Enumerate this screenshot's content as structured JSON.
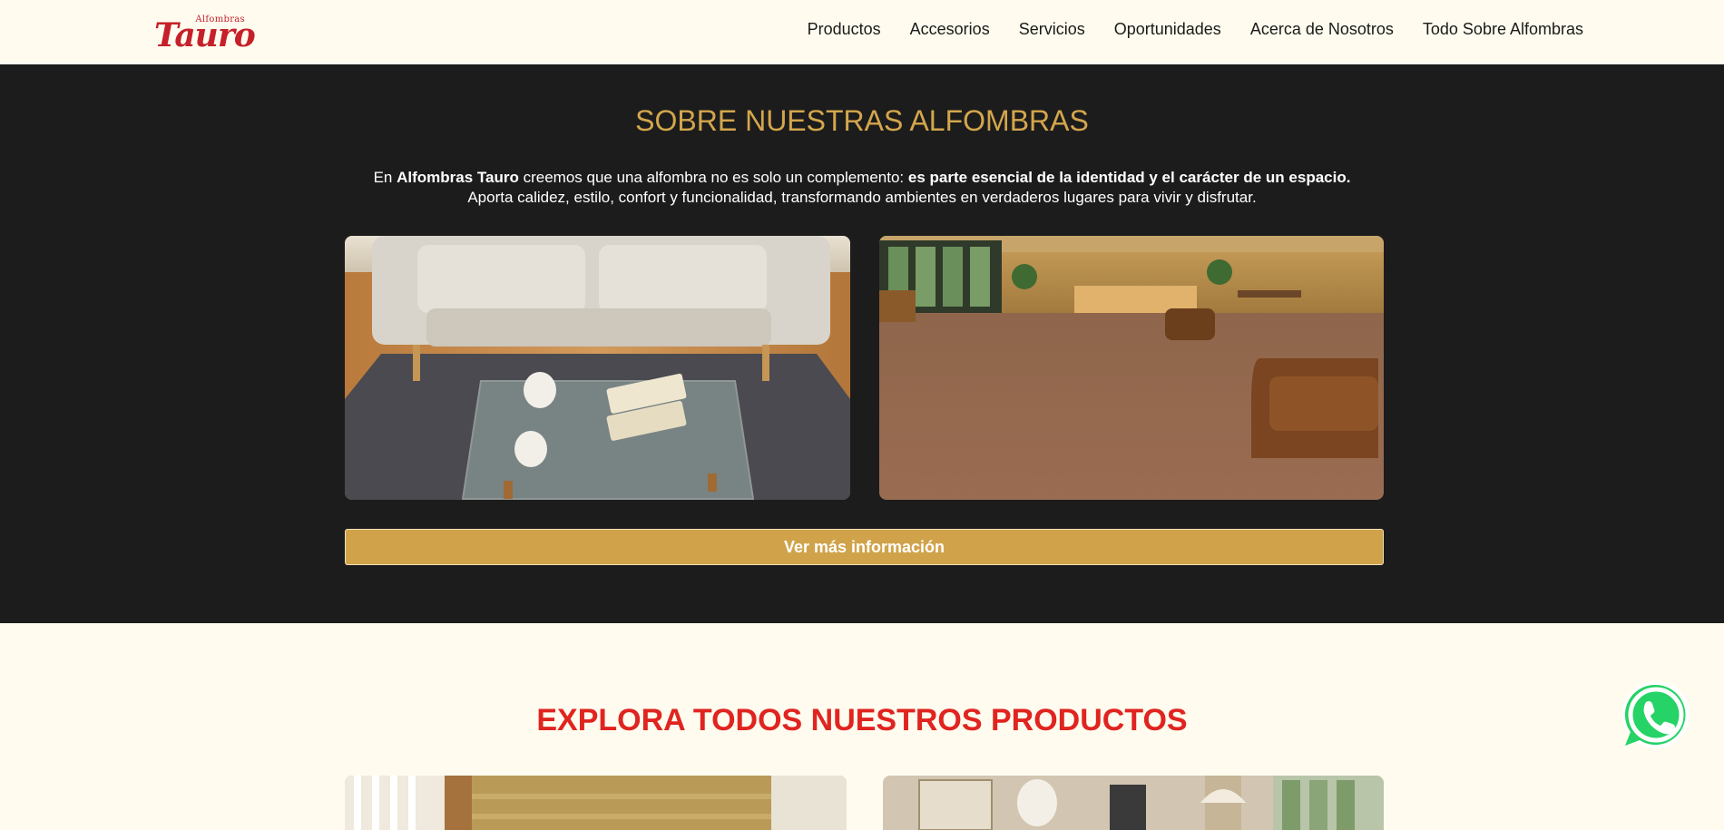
{
  "header": {
    "logo": {
      "small_text": "Alfombras",
      "big_text": "Tauro"
    },
    "nav": [
      "Productos",
      "Accesorios",
      "Servicios",
      "Oportunidades",
      "Acerca de Nosotros",
      "Todo Sobre Alfombras"
    ]
  },
  "about": {
    "title": "SOBRE NUESTRAS ALFOMBRAS",
    "line1_a": "En ",
    "line1_b": "Alfombras Tauro",
    "line1_c": " creemos que una alfombra no es solo un complemento: ",
    "line1_d": "es parte esencial de la identidad y el carácter de un espacio.",
    "line2": "Aporta calidez, estilo, confort y funcionalidad, transformando ambientes en verdaderos lugares para vivir y disfrutar.",
    "button_label": "Ver más información"
  },
  "products": {
    "title": "EXPLORA TODOS NUESTROS PRODUCTOS"
  },
  "colors": {
    "background": "#fffcef",
    "dark_section": "#1c1c1c",
    "gold": "#d4a64c",
    "red": "#e02420",
    "whatsapp_green": "#25d366"
  },
  "icons": {
    "whatsapp": "whatsapp-icon"
  }
}
